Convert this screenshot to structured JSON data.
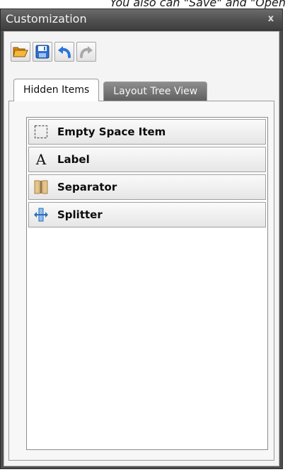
{
  "caption": "You also can \"Save\" and \"Open",
  "window": {
    "title": "Customization",
    "close_label": "x"
  },
  "toolbar": {
    "buttons": [
      {
        "name": "open",
        "icon": "folder-open-icon"
      },
      {
        "name": "save",
        "icon": "save-icon"
      },
      {
        "name": "undo",
        "icon": "undo-icon"
      },
      {
        "name": "redo",
        "icon": "redo-icon"
      }
    ]
  },
  "tabs": [
    {
      "label": "Hidden Items",
      "active": true
    },
    {
      "label": "Layout Tree View",
      "active": false
    }
  ],
  "hidden_items": [
    {
      "label": "Empty Space Item",
      "icon": "empty-space-icon"
    },
    {
      "label": "Label",
      "icon": "label-icon",
      "glyph": "A"
    },
    {
      "label": "Separator",
      "icon": "separator-icon"
    },
    {
      "label": "Splitter",
      "icon": "splitter-icon"
    }
  ],
  "colors": {
    "window_frame": "#4e4e4e",
    "titlebar_text": "#f2f2f2",
    "folder_orange": "#e79a1f",
    "save_blue": "#2e6fd0"
  }
}
